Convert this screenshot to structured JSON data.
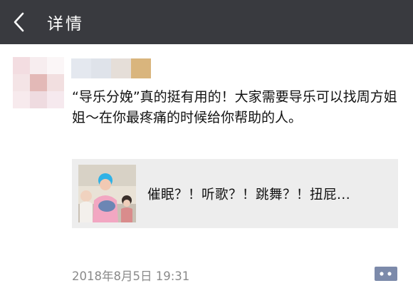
{
  "header": {
    "title": "详情",
    "back_icon": "chevron-left-icon"
  },
  "post": {
    "text": "“导乐分娩”真的挺有用的！大家需要导乐可以找周方姐姐～在你最疼痛的时候给你帮助的人。",
    "link_card": {
      "title": "催眠？！听歌？！跳舞？！扭屁..."
    },
    "timestamp": "2018年8月5日 19:31",
    "comment_icon": "comment-bubble-icon"
  },
  "colors": {
    "header_bg": "#393a3f",
    "card_bg": "#ededed",
    "timestamp": "#8a8a8a",
    "comment_icon": "#7c8aaa"
  }
}
